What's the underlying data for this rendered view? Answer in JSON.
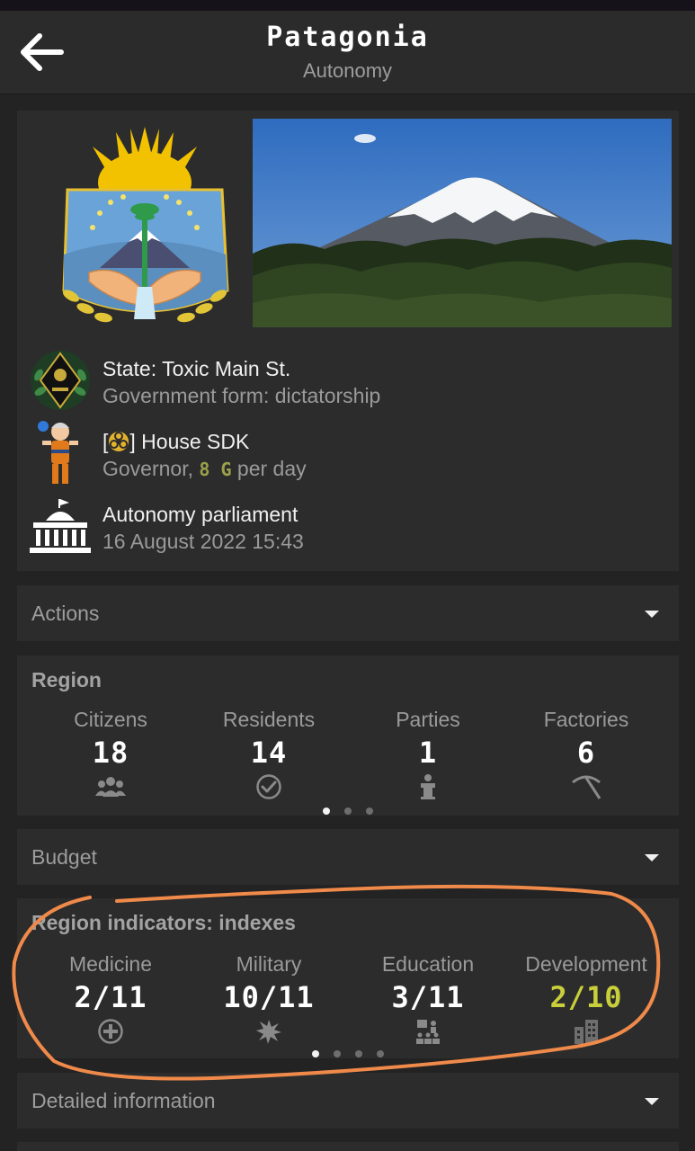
{
  "header": {
    "title": "Patagonia",
    "subtitle": "Autonomy",
    "back_icon": "arrow-left-icon"
  },
  "info": {
    "state_line": "State: Toxic Main St.",
    "government_line": "Government form: dictatorship",
    "governor_name": "House SDK",
    "governor_role": "Governor,",
    "governor_pay": "8 G",
    "governor_pay_suffix": "per day",
    "parliament_name": "Autonomy parliament",
    "parliament_date": "16 August 2022 15:43"
  },
  "actions": {
    "label": "Actions"
  },
  "region": {
    "title": "Region",
    "stats": [
      {
        "name": "Citizens",
        "value": "18",
        "icon": "users-icon"
      },
      {
        "name": "Residents",
        "value": "14",
        "icon": "check-circle-icon"
      },
      {
        "name": "Parties",
        "value": "1",
        "icon": "speaker-podium-icon"
      },
      {
        "name": "Factories",
        "value": "6",
        "icon": "pickaxe-icon"
      }
    ],
    "pages": 3,
    "active_page": 1
  },
  "budget": {
    "label": "Budget"
  },
  "indicators": {
    "title": "Region indicators: indexes",
    "stats": [
      {
        "name": "Medicine",
        "value": "2/11",
        "icon": "medical-cross-icon"
      },
      {
        "name": "Military",
        "value": "10/11",
        "icon": "explosion-icon"
      },
      {
        "name": "Education",
        "value": "3/11",
        "icon": "classroom-icon"
      },
      {
        "name": "Development",
        "value": "2/10",
        "icon": "buildings-icon"
      }
    ],
    "pages": 4,
    "active_page": 1,
    "highlight_color": "#c8cf3a"
  },
  "detailed": {
    "label": "Detailed information"
  },
  "colors": {
    "background": "#232323",
    "card": "#2c2c2c",
    "annotation": "#ef8a4a",
    "emblem_blue": "#6aa3d8",
    "sun": "#f2c200"
  }
}
